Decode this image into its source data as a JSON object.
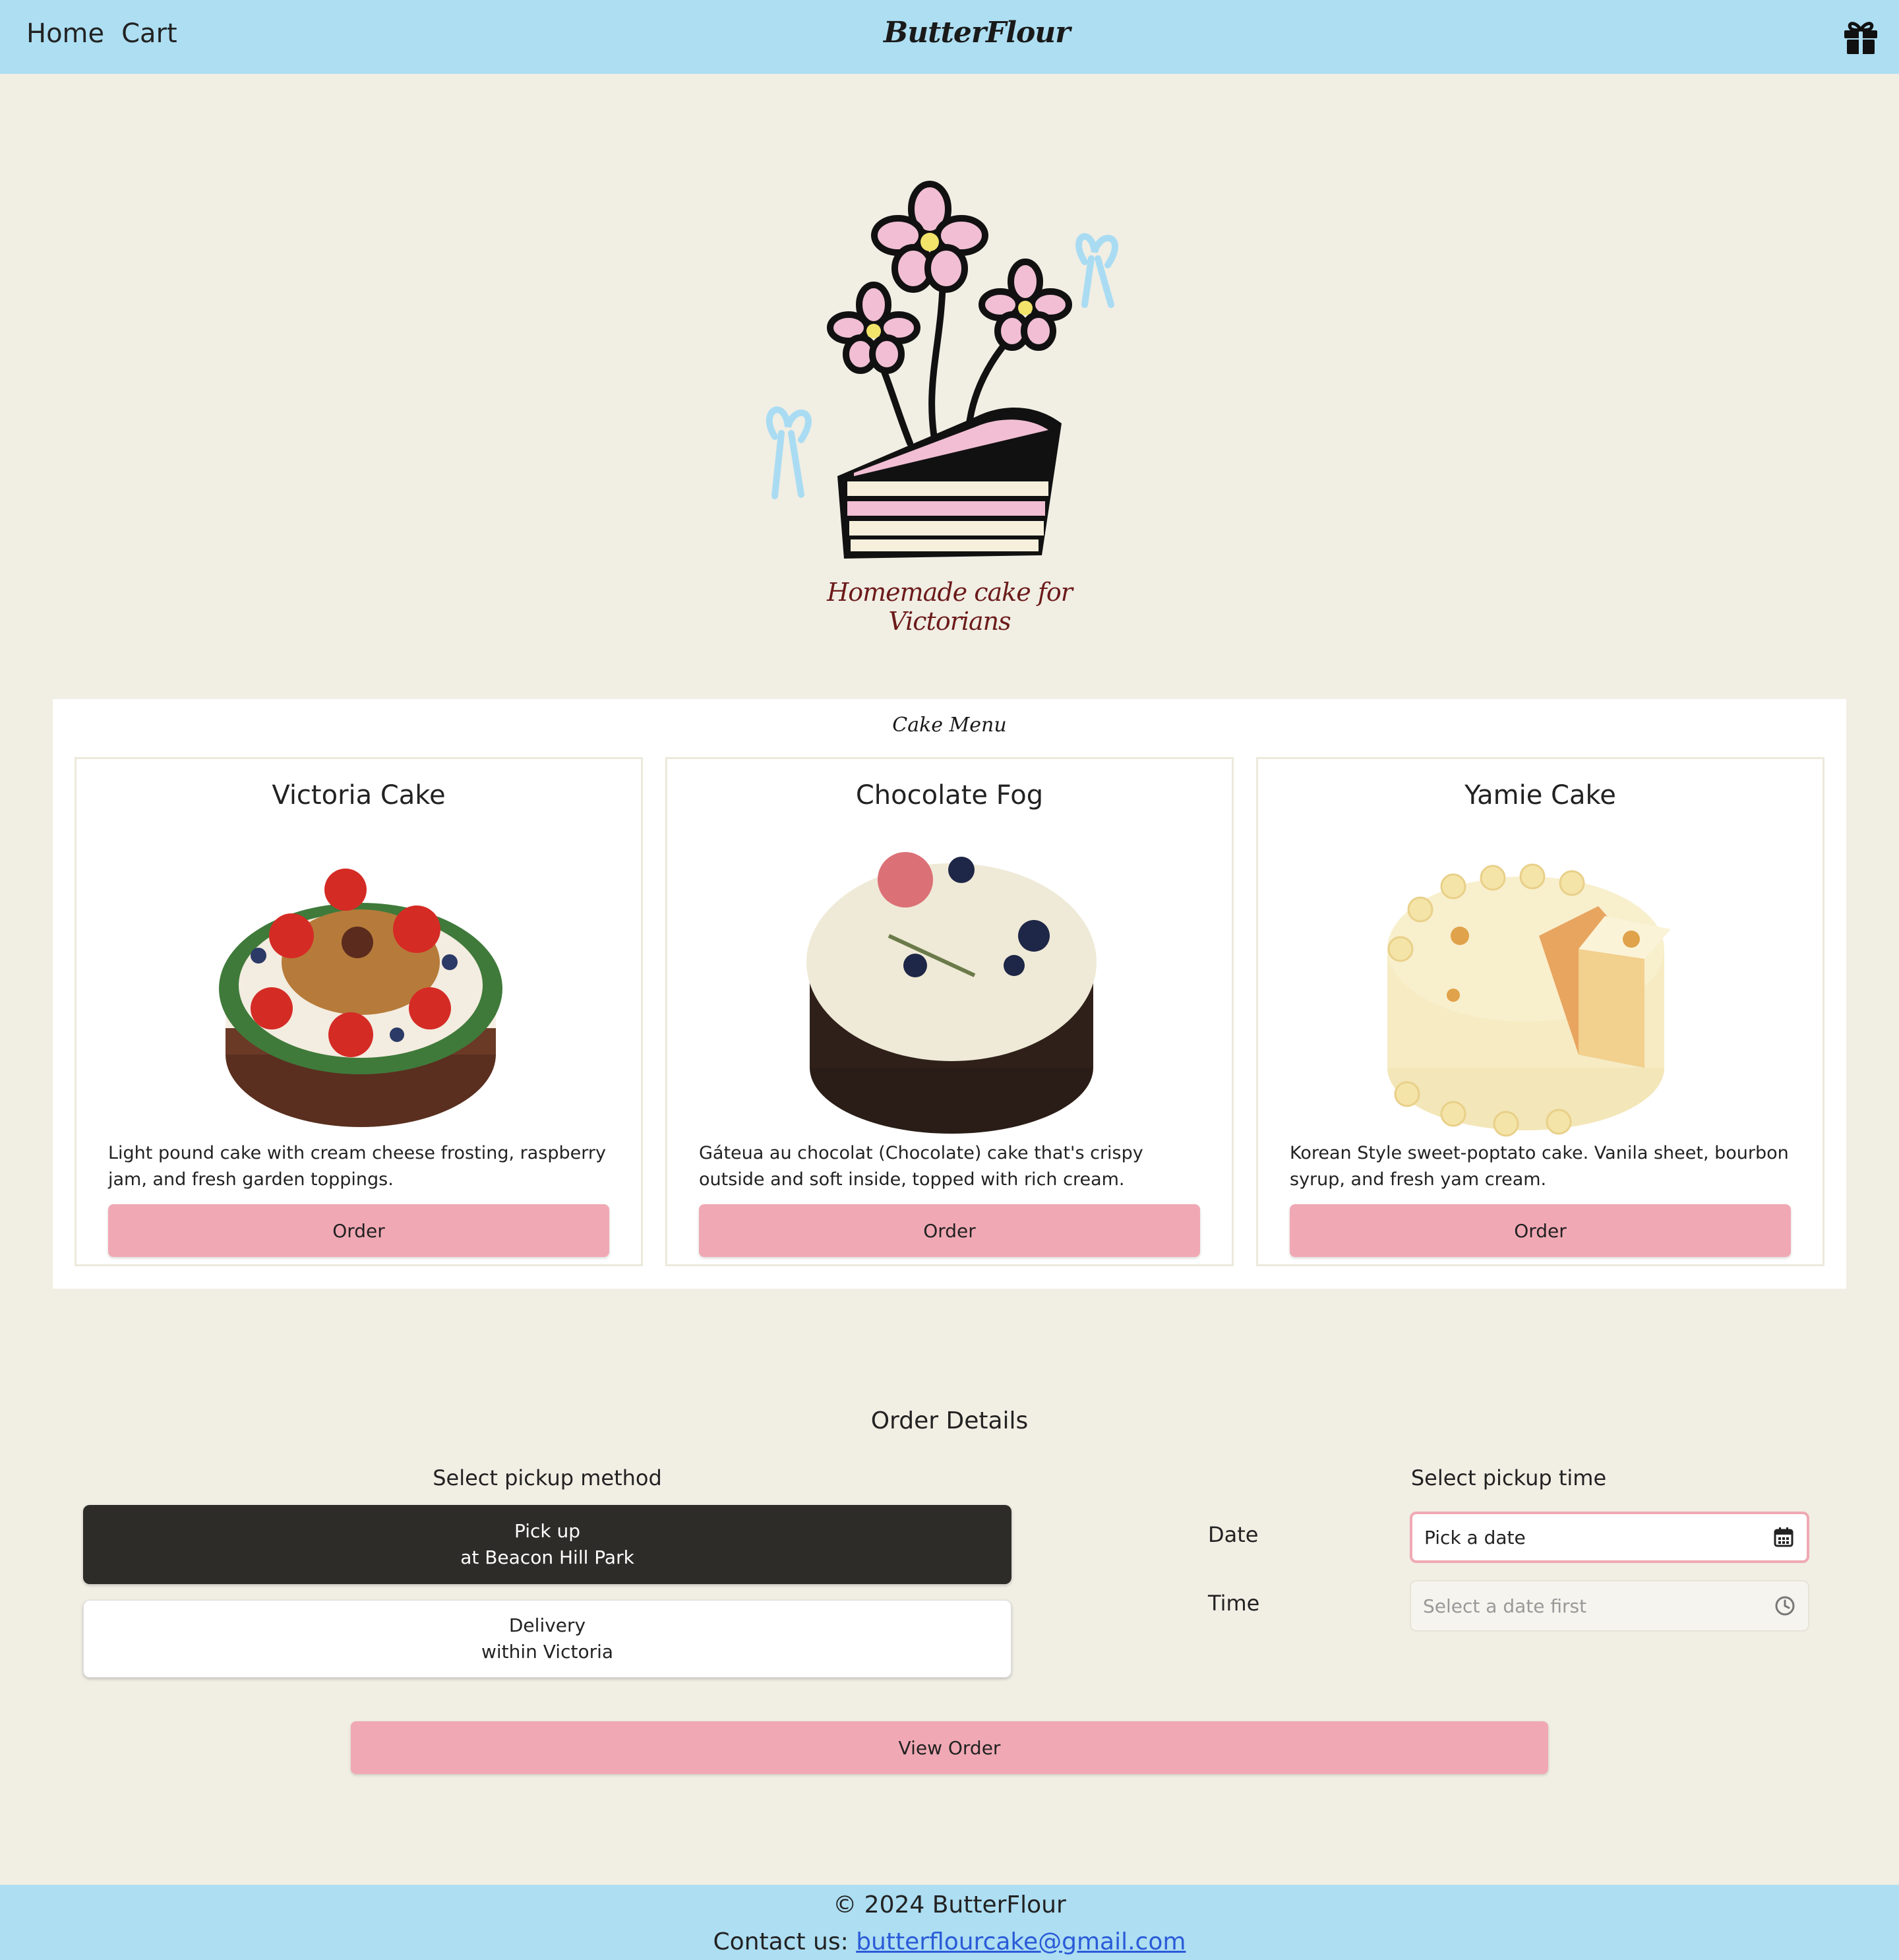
{
  "header": {
    "nav": [
      {
        "label": "Home"
      },
      {
        "label": "Cart"
      }
    ],
    "brand": "ButterFlour",
    "gift_icon": "gift-icon"
  },
  "hero": {
    "tagline": "Homemade cake for Victorians"
  },
  "menu": {
    "title": "Cake Menu",
    "cards": [
      {
        "name": "Victoria Cake",
        "description": "Light pound cake with cream cheese frosting, raspberry jam, and fresh garden toppings.",
        "button": "Order"
      },
      {
        "name": "Chocolate Fog",
        "description": "Gáteua au chocolat (Chocolate) cake that's crispy outside and soft inside, topped with rich cream.",
        "button": "Order"
      },
      {
        "name": "Yamie Cake",
        "description": "Korean Style sweet-poptato cake. Vanila sheet, bourbon syrup, and fresh yam cream.",
        "button": "Order"
      }
    ]
  },
  "order": {
    "title": "Order Details",
    "method_title": "Select pickup method",
    "time_title": "Select pickup time",
    "pickup": {
      "line1": "Pick up",
      "line2": "at Beacon Hill Park"
    },
    "delivery": {
      "line1": "Delivery",
      "line2": "within Victoria"
    },
    "date_label": "Date",
    "date_value": "Pick a date",
    "time_label": "Time",
    "time_placeholder": "Select a date first",
    "view_button": "View Order"
  },
  "footer": {
    "copyright": "© 2024 ButterFlour",
    "contact_label": "Contact us: ",
    "email": "butterflourcake@gmail.com"
  },
  "colors": {
    "header_bg": "#addef2",
    "page_bg": "#f1eee4",
    "accent_pink": "#f0a9b4",
    "selected_dark": "#2e2c28"
  }
}
